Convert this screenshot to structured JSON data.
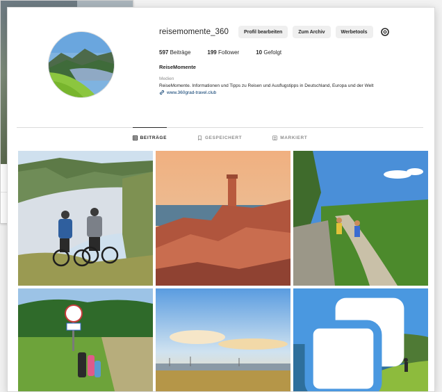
{
  "profile": {
    "username": "reisemomente_360",
    "buttons": {
      "edit": "Profil bearbeiten",
      "archive": "Zum Archiv",
      "ads": "Werbetools"
    },
    "stats": {
      "posts_count": "597",
      "posts_label": "Beiträge",
      "followers_count": "199",
      "followers_label": "Follower",
      "following_count": "10",
      "following_label": "Gefolgt"
    },
    "full_name": "ReiseMomente",
    "category": "Medien",
    "bio": "ReiseMomente. Informationen und Tipps zu Reisen und Ausflugstipps in Deutschland, Europa und der Welt",
    "link": "www.360grad-travel.club"
  },
  "tabs": [
    {
      "label": "BEITRÄGE",
      "icon": "grid-icon",
      "active": true
    },
    {
      "label": "GESPEICHERT",
      "icon": "bookmark-icon",
      "active": false
    },
    {
      "label": "MARKIERT",
      "icon": "tag-icon",
      "active": false
    }
  ],
  "posts": [
    {
      "subject": "cyclists-river-valley"
    },
    {
      "subject": "lighthouse-pink-rocks"
    },
    {
      "subject": "hikers-trail"
    },
    {
      "subject": "family-sign-fields"
    },
    {
      "subject": "harbor-sunset"
    },
    {
      "subject": "coastal-hiker",
      "icon": "multiple-photos-icon"
    }
  ],
  "colors": {
    "link": "#00376b",
    "button_bg": "#efefef",
    "muted_text": "#8e8e8e"
  }
}
